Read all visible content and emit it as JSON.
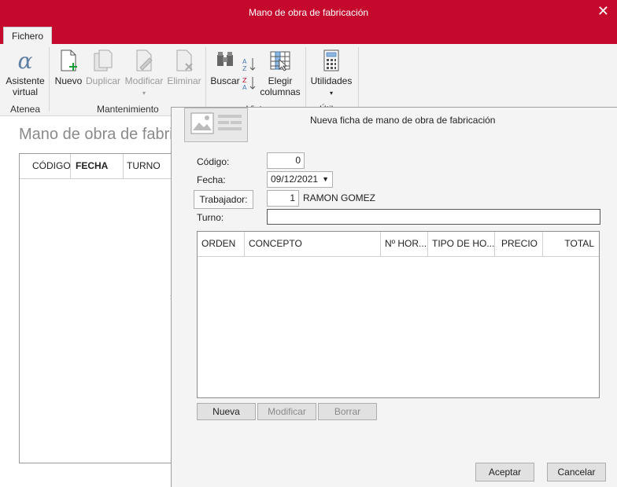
{
  "window": {
    "title": "Mano de obra de fabricación",
    "close_glyph": "✕"
  },
  "tabs": {
    "fichero": "Fichero"
  },
  "ribbon": {
    "asistente": {
      "label1": "Asistente",
      "label2": "virtual",
      "icon": "alpha-icon"
    },
    "nuevo": "Nuevo",
    "duplicar": "Duplicar",
    "modificar": "Modificar",
    "eliminar": "Eliminar",
    "buscar": "Buscar",
    "elegir": {
      "label1": "Elegir",
      "label2": "columnas"
    },
    "utilidades": "Utilidades",
    "groups": {
      "atenea": "Atenea",
      "mantenimiento": "Mantenimiento",
      "vista": "Vist",
      "util": "Útil"
    }
  },
  "main": {
    "title": "Mano de obra de fabric",
    "columns": [
      "CÓDIGO",
      "FECHA",
      "TURNO"
    ]
  },
  "expander": "›",
  "form": {
    "title": "Nueva ficha de mano de obra de fabricación",
    "codigo_label": "Código:",
    "codigo_value": "0",
    "fecha_label": "Fecha:",
    "fecha_value": "09/12/2021",
    "trabajador_label": "Trabajador:",
    "trabajador_value": "1",
    "trabajador_name": "RAMON GOMEZ",
    "turno_label": "Turno:",
    "turno_value": "",
    "grid_columns": [
      "ORDEN",
      "CONCEPTO",
      "Nº HOR...",
      "TIPO DE HO...",
      "PRECIO",
      "TOTAL"
    ],
    "buttons": {
      "nueva": "Nueva",
      "modificar": "Modificar",
      "borrar": "Borrar"
    },
    "aceptar": "Aceptar",
    "cancelar": "Cancelar"
  },
  "colors": {
    "accent": "#c4092d",
    "ribbon_bg": "#f3f3f3",
    "panel_bg": "#f4f4f4"
  }
}
